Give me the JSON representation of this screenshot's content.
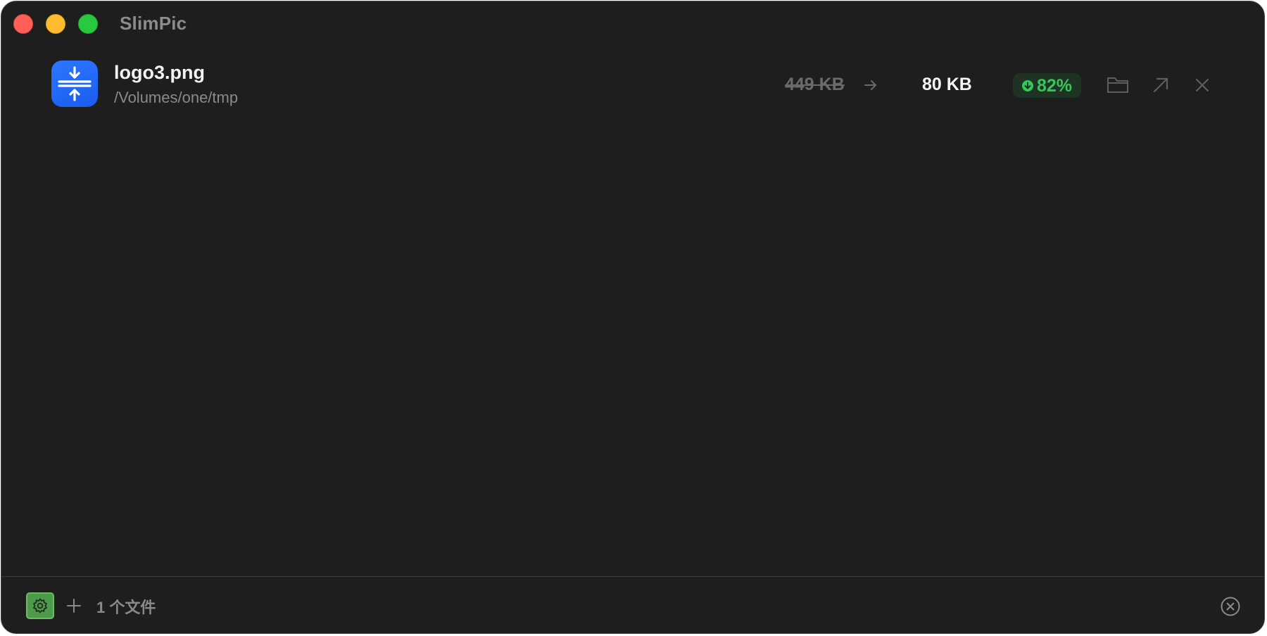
{
  "window": {
    "title": "SlimPic"
  },
  "traffic_lights": {
    "close": "close-window",
    "minimize": "minimize-window",
    "zoom": "zoom-window"
  },
  "files": [
    {
      "name": "logo3.png",
      "path": "/Volumes/one/tmp",
      "original_size": "449 KB",
      "compressed_size": "80 KB",
      "saving": "82%",
      "icon": "compress-icon"
    }
  ],
  "footer": {
    "file_count": "1 个文件"
  },
  "colors": {
    "window_bg": "#1e1e1e",
    "accent_blue": "#1a5cf0",
    "saving_green": "#35c758",
    "settings_green": "#4d9a4b"
  }
}
